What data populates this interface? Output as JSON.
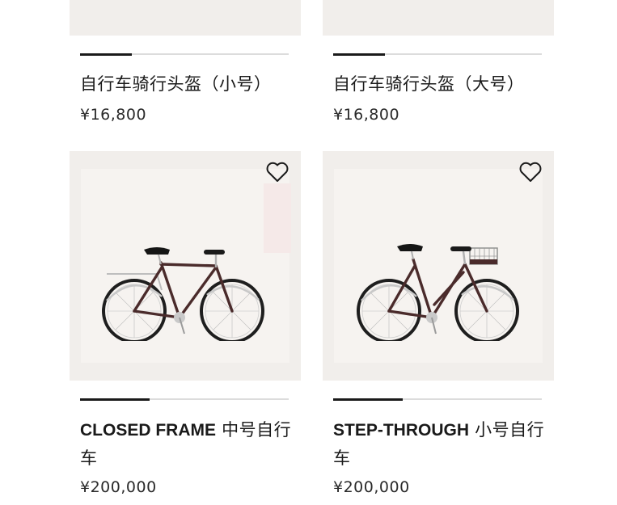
{
  "products": [
    {
      "title": "自行车骑行头盔（小号）",
      "price": "¥16,800",
      "progress": 0.25
    },
    {
      "title": "自行车骑行头盔（大号）",
      "price": "¥16,800",
      "progress": 0.25
    },
    {
      "title_latin": "CLOSED FRAME",
      "title_cjk": " 中号自行车",
      "price": "¥200,000",
      "progress": 0.33,
      "wishlist_icon": "heart-outline-icon"
    },
    {
      "title_latin": "STEP-THROUGH",
      "title_cjk": " 小号自行车",
      "price": "¥200,000",
      "progress": 0.33,
      "wishlist_icon": "heart-outline-icon"
    }
  ]
}
